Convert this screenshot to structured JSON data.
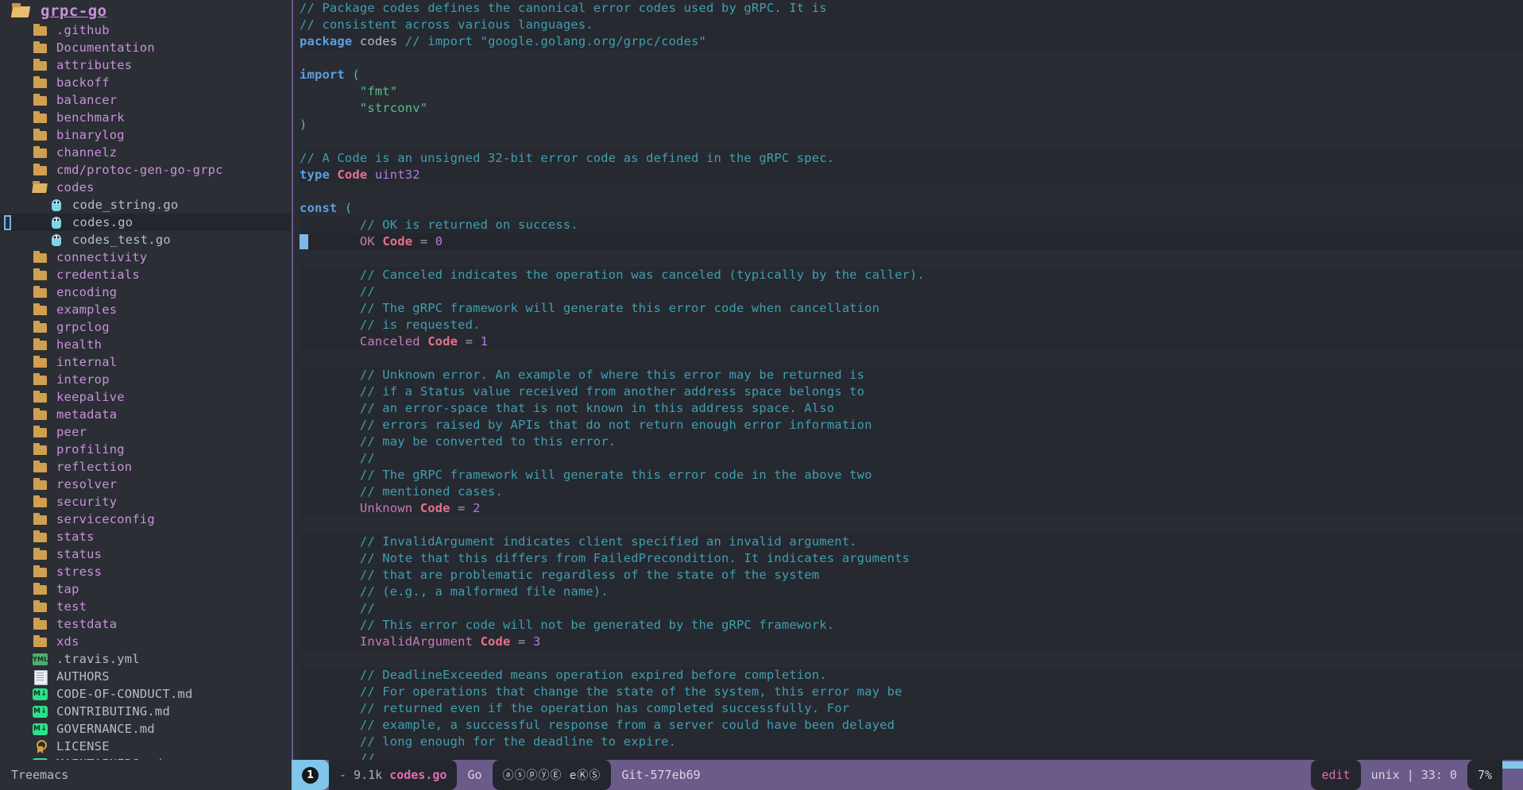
{
  "sidebar": {
    "root": {
      "label": "grpc-go",
      "icon": "folder-open-icon"
    },
    "items": [
      {
        "label": ".github",
        "icon": "folder-icon",
        "kind": "dir",
        "depth": 1
      },
      {
        "label": "Documentation",
        "icon": "folder-icon",
        "kind": "dir",
        "depth": 1
      },
      {
        "label": "attributes",
        "icon": "folder-icon",
        "kind": "dir",
        "depth": 1
      },
      {
        "label": "backoff",
        "icon": "folder-icon",
        "kind": "dir",
        "depth": 1
      },
      {
        "label": "balancer",
        "icon": "folder-icon",
        "kind": "dir",
        "depth": 1
      },
      {
        "label": "benchmark",
        "icon": "folder-icon",
        "kind": "dir",
        "depth": 1
      },
      {
        "label": "binarylog",
        "icon": "folder-icon",
        "kind": "dir",
        "depth": 1
      },
      {
        "label": "channelz",
        "icon": "folder-icon",
        "kind": "dir",
        "depth": 1
      },
      {
        "label": "cmd/protoc-gen-go-grpc",
        "icon": "folder-icon",
        "kind": "dir",
        "depth": 1
      },
      {
        "label": "codes",
        "icon": "folder-open-icon",
        "kind": "dir",
        "depth": 1
      },
      {
        "label": "code_string.go",
        "icon": "go-file-icon",
        "kind": "file",
        "depth": 2
      },
      {
        "label": "codes.go",
        "icon": "go-file-icon",
        "kind": "file",
        "depth": 2,
        "selected": true
      },
      {
        "label": "codes_test.go",
        "icon": "go-file-icon",
        "kind": "file",
        "depth": 2
      },
      {
        "label": "connectivity",
        "icon": "folder-icon",
        "kind": "dir",
        "depth": 1
      },
      {
        "label": "credentials",
        "icon": "folder-icon",
        "kind": "dir",
        "depth": 1
      },
      {
        "label": "encoding",
        "icon": "folder-icon",
        "kind": "dir",
        "depth": 1
      },
      {
        "label": "examples",
        "icon": "folder-icon",
        "kind": "dir",
        "depth": 1
      },
      {
        "label": "grpclog",
        "icon": "folder-icon",
        "kind": "dir",
        "depth": 1
      },
      {
        "label": "health",
        "icon": "folder-icon",
        "kind": "dir",
        "depth": 1
      },
      {
        "label": "internal",
        "icon": "folder-icon",
        "kind": "dir",
        "depth": 1
      },
      {
        "label": "interop",
        "icon": "folder-icon",
        "kind": "dir",
        "depth": 1
      },
      {
        "label": "keepalive",
        "icon": "folder-icon",
        "kind": "dir",
        "depth": 1
      },
      {
        "label": "metadata",
        "icon": "folder-icon",
        "kind": "dir",
        "depth": 1
      },
      {
        "label": "peer",
        "icon": "folder-icon",
        "kind": "dir",
        "depth": 1
      },
      {
        "label": "profiling",
        "icon": "folder-icon",
        "kind": "dir",
        "depth": 1
      },
      {
        "label": "reflection",
        "icon": "folder-icon",
        "kind": "dir",
        "depth": 1
      },
      {
        "label": "resolver",
        "icon": "folder-icon",
        "kind": "dir",
        "depth": 1
      },
      {
        "label": "security",
        "icon": "folder-icon",
        "kind": "dir",
        "depth": 1
      },
      {
        "label": "serviceconfig",
        "icon": "folder-icon",
        "kind": "dir",
        "depth": 1
      },
      {
        "label": "stats",
        "icon": "folder-icon",
        "kind": "dir",
        "depth": 1
      },
      {
        "label": "status",
        "icon": "folder-icon",
        "kind": "dir",
        "depth": 1
      },
      {
        "label": "stress",
        "icon": "folder-icon",
        "kind": "dir",
        "depth": 1
      },
      {
        "label": "tap",
        "icon": "folder-icon",
        "kind": "dir",
        "depth": 1
      },
      {
        "label": "test",
        "icon": "folder-icon",
        "kind": "dir",
        "depth": 1
      },
      {
        "label": "testdata",
        "icon": "folder-icon",
        "kind": "dir",
        "depth": 1
      },
      {
        "label": "xds",
        "icon": "folder-icon",
        "kind": "dir",
        "depth": 1
      },
      {
        "label": ".travis.yml",
        "icon": "yml-file-icon",
        "kind": "file",
        "depth": 1
      },
      {
        "label": "AUTHORS",
        "icon": "document-file-icon",
        "kind": "file",
        "depth": 1
      },
      {
        "label": "CODE-OF-CONDUCT.md",
        "icon": "markdown-file-icon",
        "kind": "file",
        "depth": 1
      },
      {
        "label": "CONTRIBUTING.md",
        "icon": "markdown-file-icon",
        "kind": "file",
        "depth": 1
      },
      {
        "label": "GOVERNANCE.md",
        "icon": "markdown-file-icon",
        "kind": "file",
        "depth": 1
      },
      {
        "label": "LICENSE",
        "icon": "license-file-icon",
        "kind": "file",
        "depth": 1
      },
      {
        "label": "MAINTAINERS.md",
        "icon": "markdown-file-icon",
        "kind": "file",
        "depth": 1
      }
    ]
  },
  "editor": {
    "lines": [
      {
        "stripe": true,
        "tokens": [
          {
            "t": "// Package codes defines the canonical error codes used by gRPC. It is",
            "c": "cm"
          }
        ]
      },
      {
        "stripe": true,
        "tokens": [
          {
            "t": "// consistent across various languages.",
            "c": "cm"
          }
        ]
      },
      {
        "stripe": true,
        "tokens": [
          {
            "t": "package",
            "c": "kw"
          },
          {
            "t": " ",
            "c": "pkg"
          },
          {
            "t": "codes",
            "c": "pkg"
          },
          {
            "t": " ",
            "c": "pkg"
          },
          {
            "t": "// import \"google.golang.org/grpc/codes\"",
            "c": "cm"
          }
        ]
      },
      {
        "stripe": false,
        "tokens": []
      },
      {
        "stripe": false,
        "tokens": [
          {
            "t": "import",
            "c": "kw"
          },
          {
            "t": " ",
            "c": "pkg"
          },
          {
            "t": "(",
            "c": "pun"
          }
        ]
      },
      {
        "stripe": false,
        "tokens": [
          {
            "t": "        ",
            "c": "pkg"
          },
          {
            "t": "\"fmt\"",
            "c": "str"
          }
        ]
      },
      {
        "stripe": false,
        "tokens": [
          {
            "t": "        ",
            "c": "pkg"
          },
          {
            "t": "\"strconv\"",
            "c": "str"
          }
        ]
      },
      {
        "stripe": false,
        "tokens": [
          {
            "t": ")",
            "c": "pun"
          }
        ]
      },
      {
        "stripe": false,
        "tokens": []
      },
      {
        "stripe": true,
        "tokens": [
          {
            "t": "// A Code is an unsigned 32-bit error code as defined in the gRPC spec.",
            "c": "cm"
          }
        ]
      },
      {
        "stripe": true,
        "tokens": [
          {
            "t": "type",
            "c": "kw"
          },
          {
            "t": " ",
            "c": "pkg"
          },
          {
            "t": "Code",
            "c": "typ"
          },
          {
            "t": " ",
            "c": "pkg"
          },
          {
            "t": "uint32",
            "c": "num"
          }
        ]
      },
      {
        "stripe": false,
        "tokens": []
      },
      {
        "stripe": false,
        "tokens": [
          {
            "t": "const",
            "c": "kw"
          },
          {
            "t": " ",
            "c": "pkg"
          },
          {
            "t": "(",
            "c": "pun"
          }
        ]
      },
      {
        "stripe": true,
        "tokens": [
          {
            "t": "        ",
            "c": "pkg"
          },
          {
            "t": "// OK is returned on success.",
            "c": "cm"
          }
        ]
      },
      {
        "cursor": true,
        "tokens": [
          {
            "t": "        ",
            "c": "pkg"
          },
          {
            "t": "OK",
            "c": "con"
          },
          {
            "t": " ",
            "c": "pkg"
          },
          {
            "t": "Code",
            "c": "typ"
          },
          {
            "t": " = ",
            "c": "op"
          },
          {
            "t": "0",
            "c": "num"
          }
        ]
      },
      {
        "stripe": false,
        "tokens": []
      },
      {
        "stripe": true,
        "tokens": [
          {
            "t": "        ",
            "c": "pkg"
          },
          {
            "t": "// Canceled indicates the operation was canceled (typically by the caller).",
            "c": "cm"
          }
        ]
      },
      {
        "stripe": true,
        "tokens": [
          {
            "t": "        ",
            "c": "pkg"
          },
          {
            "t": "//",
            "c": "cm"
          }
        ]
      },
      {
        "stripe": true,
        "tokens": [
          {
            "t": "        ",
            "c": "pkg"
          },
          {
            "t": "// The gRPC framework will generate this error code when cancellation",
            "c": "cm"
          }
        ]
      },
      {
        "stripe": true,
        "tokens": [
          {
            "t": "        ",
            "c": "pkg"
          },
          {
            "t": "// is requested.",
            "c": "cm"
          }
        ]
      },
      {
        "stripe": true,
        "tokens": [
          {
            "t": "        ",
            "c": "pkg"
          },
          {
            "t": "Canceled",
            "c": "con"
          },
          {
            "t": " ",
            "c": "pkg"
          },
          {
            "t": "Code",
            "c": "typ"
          },
          {
            "t": " = ",
            "c": "op"
          },
          {
            "t": "1",
            "c": "num"
          }
        ]
      },
      {
        "stripe": false,
        "tokens": []
      },
      {
        "stripe": true,
        "tokens": [
          {
            "t": "        ",
            "c": "pkg"
          },
          {
            "t": "// Unknown error. An example of where this error may be returned is",
            "c": "cm"
          }
        ]
      },
      {
        "stripe": true,
        "tokens": [
          {
            "t": "        ",
            "c": "pkg"
          },
          {
            "t": "// if a Status value received from another address space belongs to",
            "c": "cm"
          }
        ]
      },
      {
        "stripe": true,
        "tokens": [
          {
            "t": "        ",
            "c": "pkg"
          },
          {
            "t": "// an error-space that is not known in this address space. Also",
            "c": "cm"
          }
        ]
      },
      {
        "stripe": true,
        "tokens": [
          {
            "t": "        ",
            "c": "pkg"
          },
          {
            "t": "// errors raised by APIs that do not return enough error information",
            "c": "cm"
          }
        ]
      },
      {
        "stripe": true,
        "tokens": [
          {
            "t": "        ",
            "c": "pkg"
          },
          {
            "t": "// may be converted to this error.",
            "c": "cm"
          }
        ]
      },
      {
        "stripe": true,
        "tokens": [
          {
            "t": "        ",
            "c": "pkg"
          },
          {
            "t": "//",
            "c": "cm"
          }
        ]
      },
      {
        "stripe": true,
        "tokens": [
          {
            "t": "        ",
            "c": "pkg"
          },
          {
            "t": "// The gRPC framework will generate this error code in the above two",
            "c": "cm"
          }
        ]
      },
      {
        "stripe": true,
        "tokens": [
          {
            "t": "        ",
            "c": "pkg"
          },
          {
            "t": "// mentioned cases.",
            "c": "cm"
          }
        ]
      },
      {
        "stripe": true,
        "tokens": [
          {
            "t": "        ",
            "c": "pkg"
          },
          {
            "t": "Unknown",
            "c": "con"
          },
          {
            "t": " ",
            "c": "pkg"
          },
          {
            "t": "Code",
            "c": "typ"
          },
          {
            "t": " = ",
            "c": "op"
          },
          {
            "t": "2",
            "c": "num"
          }
        ]
      },
      {
        "stripe": false,
        "tokens": []
      },
      {
        "stripe": true,
        "tokens": [
          {
            "t": "        ",
            "c": "pkg"
          },
          {
            "t": "// InvalidArgument indicates client specified an invalid argument.",
            "c": "cm"
          }
        ]
      },
      {
        "stripe": true,
        "tokens": [
          {
            "t": "        ",
            "c": "pkg"
          },
          {
            "t": "// Note that this differs from FailedPrecondition. It indicates arguments",
            "c": "cm"
          }
        ]
      },
      {
        "stripe": true,
        "tokens": [
          {
            "t": "        ",
            "c": "pkg"
          },
          {
            "t": "// that are problematic regardless of the state of the system",
            "c": "cm"
          }
        ]
      },
      {
        "stripe": true,
        "tokens": [
          {
            "t": "        ",
            "c": "pkg"
          },
          {
            "t": "// (e.g., a malformed file name).",
            "c": "cm"
          }
        ]
      },
      {
        "stripe": true,
        "tokens": [
          {
            "t": "        ",
            "c": "pkg"
          },
          {
            "t": "//",
            "c": "cm"
          }
        ]
      },
      {
        "stripe": true,
        "tokens": [
          {
            "t": "        ",
            "c": "pkg"
          },
          {
            "t": "// This error code will not be generated by the gRPC framework.",
            "c": "cm"
          }
        ]
      },
      {
        "stripe": true,
        "tokens": [
          {
            "t": "        ",
            "c": "pkg"
          },
          {
            "t": "InvalidArgument",
            "c": "con"
          },
          {
            "t": " ",
            "c": "pkg"
          },
          {
            "t": "Code",
            "c": "typ"
          },
          {
            "t": " = ",
            "c": "op"
          },
          {
            "t": "3",
            "c": "num"
          }
        ]
      },
      {
        "stripe": false,
        "tokens": []
      },
      {
        "stripe": true,
        "tokens": [
          {
            "t": "        ",
            "c": "pkg"
          },
          {
            "t": "// DeadlineExceeded means operation expired before completion.",
            "c": "cm"
          }
        ]
      },
      {
        "stripe": true,
        "tokens": [
          {
            "t": "        ",
            "c": "pkg"
          },
          {
            "t": "// For operations that change the state of the system, this error may be",
            "c": "cm"
          }
        ]
      },
      {
        "stripe": true,
        "tokens": [
          {
            "t": "        ",
            "c": "pkg"
          },
          {
            "t": "// returned even if the operation has completed successfully. For",
            "c": "cm"
          }
        ]
      },
      {
        "stripe": true,
        "tokens": [
          {
            "t": "        ",
            "c": "pkg"
          },
          {
            "t": "// example, a successful response from a server could have been delayed",
            "c": "cm"
          }
        ]
      },
      {
        "stripe": true,
        "tokens": [
          {
            "t": "        ",
            "c": "pkg"
          },
          {
            "t": "// long enough for the deadline to expire.",
            "c": "cm"
          }
        ]
      },
      {
        "stripe": true,
        "tokens": [
          {
            "t": "        ",
            "c": "pkg"
          },
          {
            "t": "//",
            "c": "cm"
          }
        ]
      }
    ]
  },
  "modeline": {
    "treemacs_label": "Treemacs",
    "workspace_number": "1",
    "buffer_size": "- 9.1k",
    "buffer_name": "codes.go",
    "major_mode": "Go",
    "minor_modes": "ⓐⓢⓟⓨⒺ eⓀⓈ",
    "vcs": "Git-577eb69",
    "edit_state": "edit",
    "encoding": "unix | 33: 0",
    "scroll_percent": "7%"
  }
}
